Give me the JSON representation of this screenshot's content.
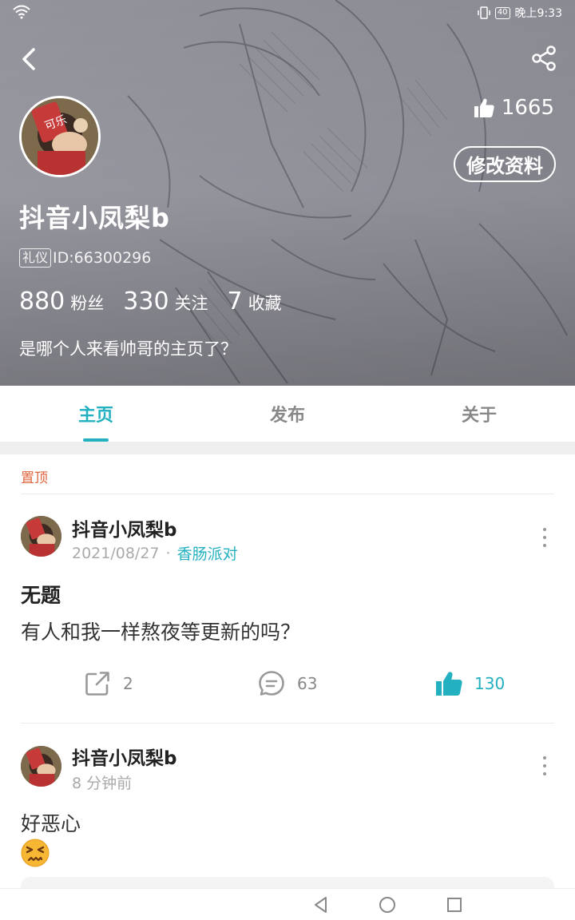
{
  "status_bar": {
    "time": "晚上9:33",
    "battery": "40"
  },
  "profile": {
    "name": "抖音小凤梨b",
    "badge": "礼仪",
    "id_text": "ID:66300296",
    "likes": "1665",
    "edit_label": "修改资料",
    "stats": [
      {
        "num": "880",
        "label": "粉丝"
      },
      {
        "num": "330",
        "label": "关注"
      },
      {
        "num": "7",
        "label": "收藏"
      }
    ],
    "bio": "是哪个人来看帅哥的主页了？"
  },
  "tabs": [
    {
      "label": "主页",
      "active": true
    },
    {
      "label": "发布",
      "active": false
    },
    {
      "label": "关于",
      "active": false
    }
  ],
  "feed": {
    "pinned_label": "置顶",
    "posts": [
      {
        "author": "抖音小凤梨b",
        "date": "2021/08/27",
        "topic": "香肠派对",
        "title": "无题",
        "body": "有人和我一样熬夜等更新的吗？",
        "shares": "2",
        "comments": "63",
        "likes": "130"
      },
      {
        "author": "抖音小凤梨b",
        "date": "8 分钟前",
        "body": "好恶心",
        "emoji": "persevering-face-emoji"
      }
    ]
  },
  "colors": {
    "accent": "#23b0c1",
    "pinned": "#e0643b"
  },
  "icons": {
    "back": "back-arrow-icon",
    "share": "share-icon",
    "thumb": "thumbs-up-icon",
    "forward": "forward-icon",
    "comment": "comment-icon"
  }
}
